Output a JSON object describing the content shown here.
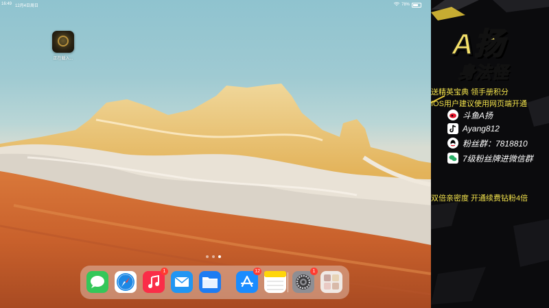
{
  "status_bar": {
    "time": "16:49",
    "date": "12月4日周日",
    "battery": "78%"
  },
  "home_screen": {
    "app": {
      "label": "正在载入...",
      "icon": "game-app-icon"
    },
    "page_dots": {
      "count": 3,
      "active": 2
    }
  },
  "dock": {
    "apps": [
      {
        "name": "messages",
        "icon": "messages-icon",
        "color": "#34c759",
        "badge": ""
      },
      {
        "name": "safari",
        "icon": "safari-icon",
        "color": "#1e88e5",
        "badge": ""
      },
      {
        "name": "music",
        "icon": "music-icon",
        "color": "#fa2d48",
        "badge": "1"
      },
      {
        "name": "mail",
        "icon": "mail-icon",
        "color": "#2196f3",
        "badge": ""
      },
      {
        "name": "files",
        "icon": "files-icon",
        "color": "#1e7cf2",
        "badge": ""
      },
      {
        "name": "app-store",
        "icon": "app-store-icon",
        "color": "#1a8cff",
        "badge": "12"
      },
      {
        "name": "notes",
        "icon": "notes-icon",
        "color": "#ffd60a",
        "badge": ""
      },
      {
        "name": "settings",
        "icon": "settings-icon",
        "color": "#8e8e93",
        "badge": "1"
      },
      {
        "name": "recent-app",
        "icon": "recent-app-icon",
        "color": "#f0eae6",
        "badge": ""
      }
    ]
  },
  "stream_panel": {
    "title": "A扬",
    "subtitle": "身法怪",
    "promo_line_1": "送精英宝典 领手册积分",
    "promo_line_2": "IOS用户建议使用网页端开通",
    "social": [
      {
        "icon": "weibo-icon",
        "text": "斗鱼A扬"
      },
      {
        "icon": "tiktok-icon",
        "text": "Ayang812"
      },
      {
        "icon": "qq-icon",
        "text": "粉丝群：7818810"
      },
      {
        "icon": "wechat-icon",
        "text": "7级粉丝牌进微信群"
      }
    ],
    "bottom_promo": "双倍亲密度 开通续费钻粉4倍"
  }
}
